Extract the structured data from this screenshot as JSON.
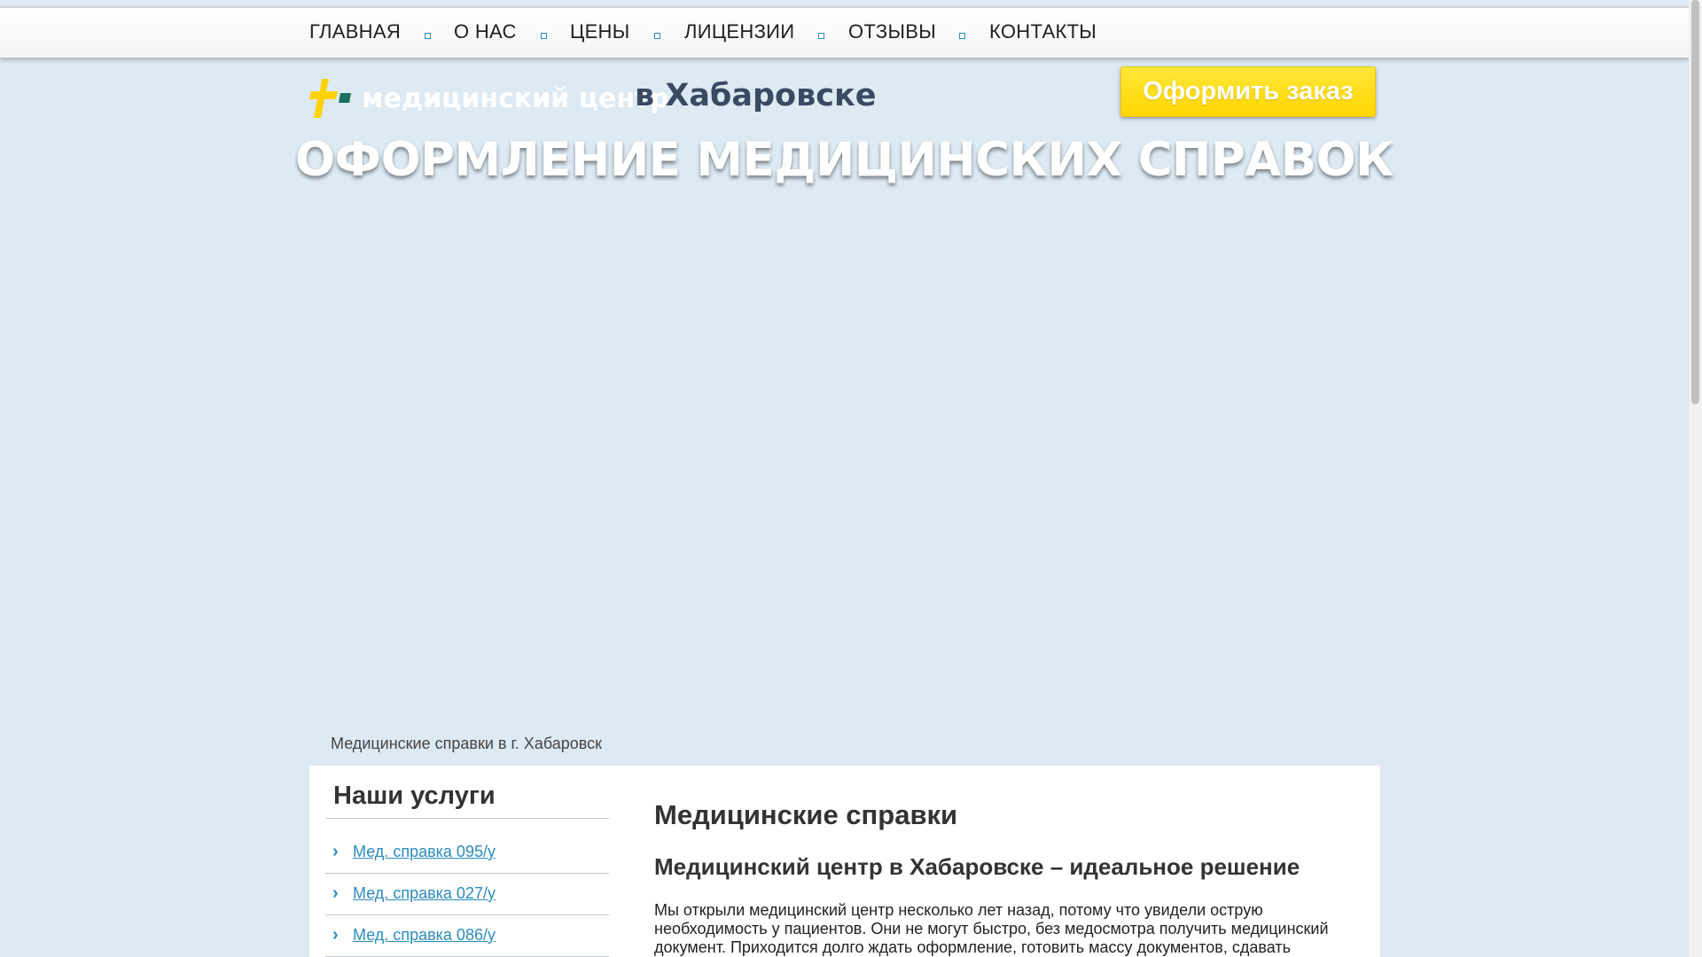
{
  "nav": {
    "items": [
      "ГЛАВНАЯ",
      "О НАС",
      "ЦЕНЫ",
      "ЛИЦЕНЗИИ",
      "ОТЗЫВЫ",
      "КОНТАКТЫ"
    ]
  },
  "header": {
    "logo_text_1": "медицинский центр",
    "logo_text_2": "в Хабаровске",
    "order_button": "Оформить заказ",
    "hero_title": "ОФОРМЛЕНИЕ МЕДИЦИНСКИХ СПРАВОК"
  },
  "breadcrumb": "Медицинские справки в г. Хабаровск",
  "sidebar": {
    "title": "Наши услуги",
    "links": [
      "Мед. справка 095/у",
      "Мед. справка 027/у",
      "Мед. справка 086/у"
    ]
  },
  "main": {
    "h1": "Медицинские справки",
    "h2": "Медицинский центр в Хабаровске – идеальное решение",
    "paragraph": "Мы открыли медицинский центр несколько лет назад, потому что увидели острую необходимость у пациентов. Они не могут быстро, без медосмотра получить медицинский документ. Приходится долго ждать оформление, готовить массу документов, сдавать"
  },
  "colors": {
    "background": "#dde9f3",
    "accent": "#2b8bbf",
    "button": "#ffd600",
    "logo_dark": "#3a4a63"
  }
}
